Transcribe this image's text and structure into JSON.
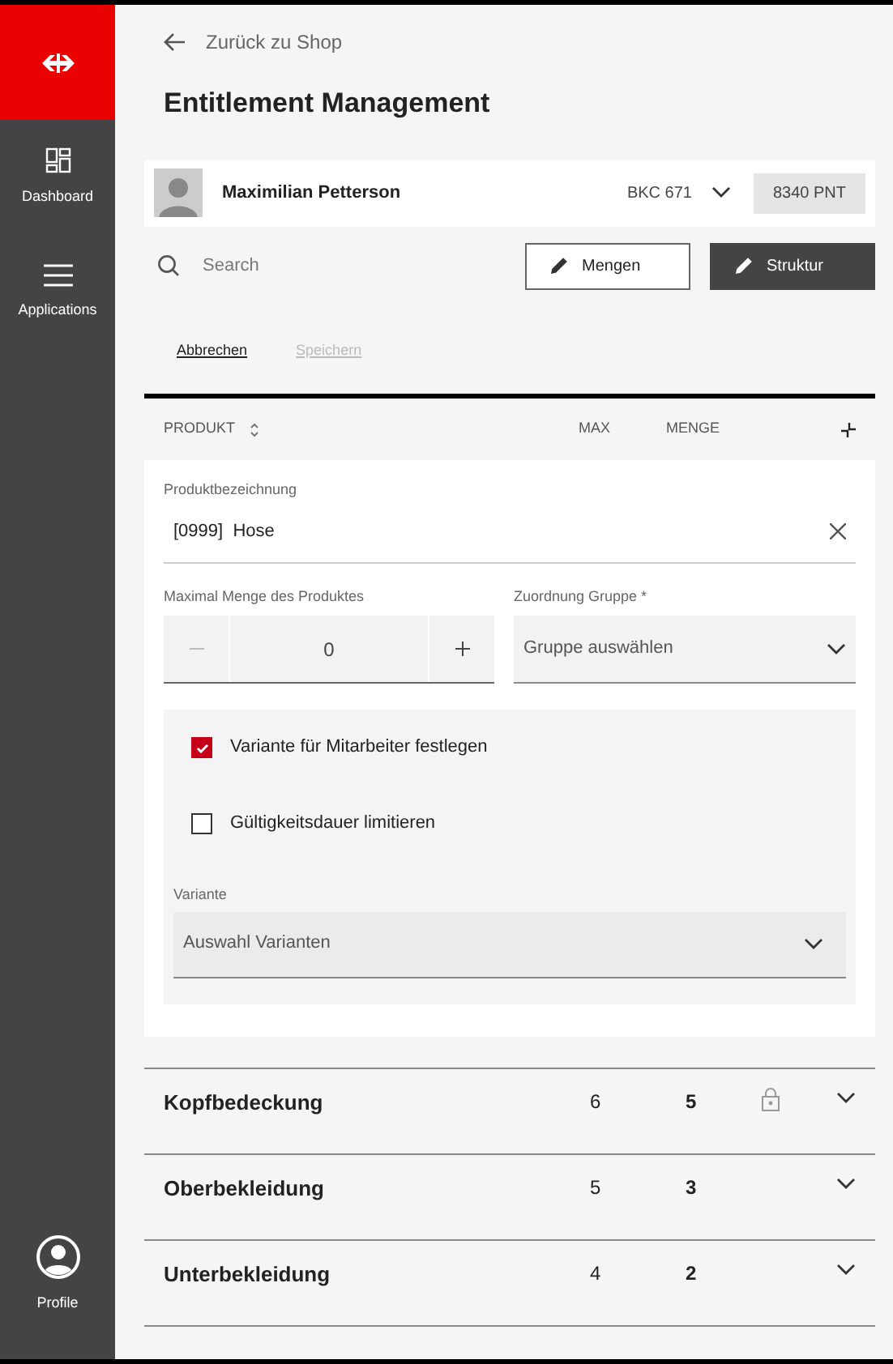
{
  "sidebar": {
    "items": [
      {
        "label": "Dashboard",
        "kind": "dashboard"
      },
      {
        "label": "Applications",
        "kind": "menu"
      }
    ],
    "profile": "Profile"
  },
  "back_link": "Zurück zu Shop",
  "title": "Entitlement Management",
  "user": {
    "name": "Maximilian Petterson",
    "account": "BKC 671",
    "points": "8340 PNT"
  },
  "search": {
    "placeholder": "Search"
  },
  "buttons": [
    {
      "label": "Mengen",
      "kind": "outline"
    },
    {
      "label": "Struktur",
      "kind": "filled"
    }
  ],
  "actions": [
    {
      "label": "Abbrechen",
      "disabled": false
    },
    {
      "label": "Speichern",
      "disabled": true
    }
  ],
  "table": {
    "columns": [
      "PRODUKT",
      "MAX",
      "MENGE"
    ],
    "form": {
      "name_label": "Produktbezeichnung",
      "code": "[0999]",
      "name": "Hose",
      "qty_label": "Maximal Menge des Produktes",
      "qty": "0",
      "group_label": "Zuordnung Gruppe *",
      "group_placeholder": "Gruppe auswählen",
      "options": [
        {
          "label": "Variante für Mitarbeiter festlegen",
          "checked": true
        },
        {
          "label": "Gültigkeitsdauer limitieren",
          "checked": false
        }
      ],
      "variant_label": "Variante",
      "variant_placeholder": "Auswahl Varianten"
    },
    "rows": [
      {
        "name": "Kopfbedeckung",
        "max": "6",
        "menge": "5",
        "locked": true
      },
      {
        "name": "Oberbekleidung",
        "max": "5",
        "menge": "3",
        "locked": false
      },
      {
        "name": "Unterbekleidung",
        "max": "4",
        "menge": "2",
        "locked": false
      }
    ]
  }
}
